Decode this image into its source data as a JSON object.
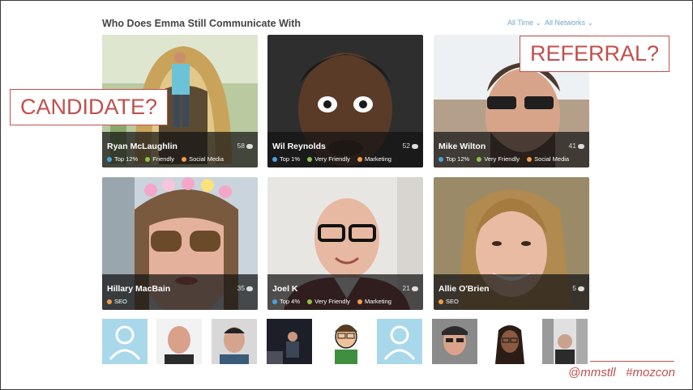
{
  "section_title": "Who Does Emma Still Communicate With",
  "filters": {
    "time": "All Time",
    "networks": "All Networks"
  },
  "cards": [
    {
      "name": "Ryan McLaughlin",
      "count": "58",
      "tags": [
        {
          "label": "Top 12%",
          "color": "blue"
        },
        {
          "label": "Friendly",
          "color": "green"
        },
        {
          "label": "Social Media",
          "color": "orange"
        }
      ]
    },
    {
      "name": "Wil Reynolds",
      "count": "52",
      "tags": [
        {
          "label": "Top 1%",
          "color": "blue"
        },
        {
          "label": "Very Friendly",
          "color": "green"
        },
        {
          "label": "Marketing",
          "color": "orange"
        }
      ]
    },
    {
      "name": "Mike Wilton",
      "count": "41",
      "tags": [
        {
          "label": "Top 12%",
          "color": "blue"
        },
        {
          "label": "Very Friendly",
          "color": "green"
        },
        {
          "label": "Social Media",
          "color": "orange"
        }
      ]
    },
    {
      "name": "Hillary MacBain",
      "count": "35",
      "tags": [
        {
          "label": "SEO",
          "color": "orange"
        }
      ]
    },
    {
      "name": "Joel K",
      "count": "21",
      "tags": [
        {
          "label": "Top 4%",
          "color": "blue"
        },
        {
          "label": "Very Friendly",
          "color": "green"
        },
        {
          "label": "Marketing",
          "color": "orange"
        }
      ]
    },
    {
      "name": "Allie O'Brien",
      "count": "5",
      "tags": [
        {
          "label": "SEO",
          "color": "orange"
        }
      ]
    }
  ],
  "callouts": {
    "left": "CANDIDATE?",
    "right": "REFERRAL?"
  },
  "footer": {
    "handle": "@mmstll",
    "hashtag": "#mozcon"
  },
  "colors": {
    "accent": "#c0504d",
    "link": "#6fa6d6",
    "tag_blue": "#4aa3df",
    "tag_green": "#8bc34a",
    "tag_orange": "#f39c49"
  }
}
